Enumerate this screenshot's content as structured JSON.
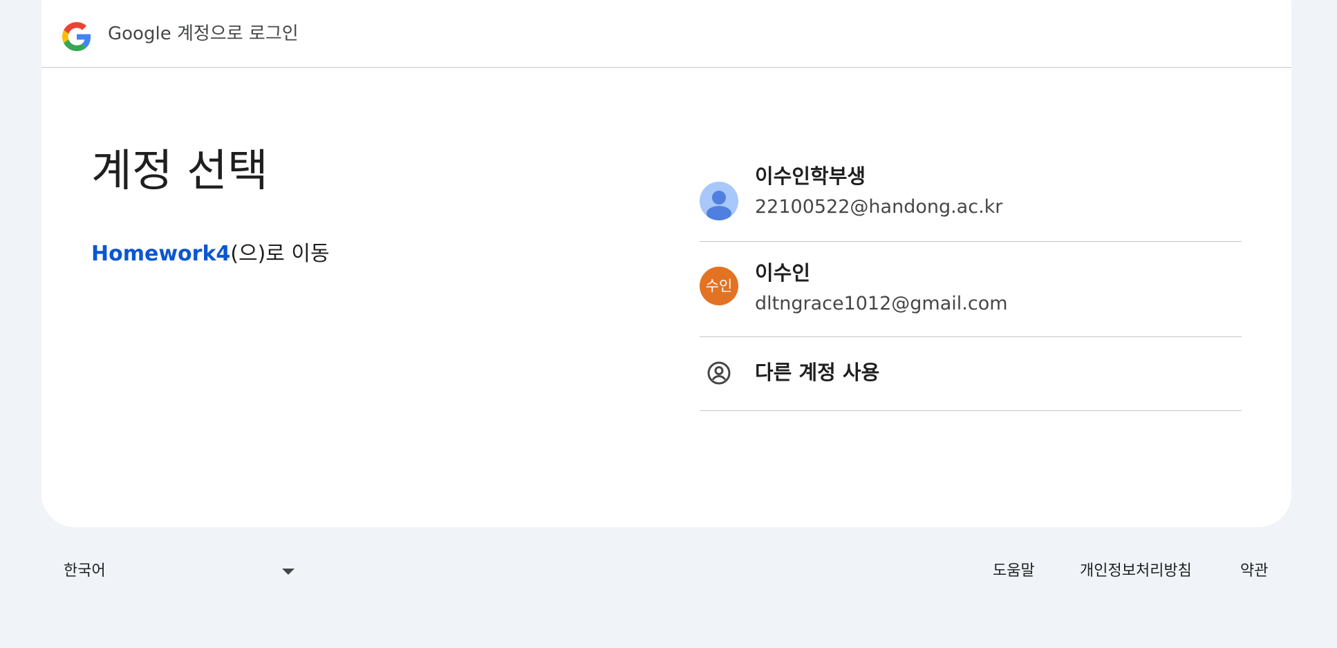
{
  "header": {
    "logo_icon": "google-g-logo",
    "title": "Google 계정으로 로그인"
  },
  "main": {
    "heading": "계정 선택",
    "continue_app_name": "Homework4",
    "continue_suffix": "(으)로 이동"
  },
  "accounts": [
    {
      "name": "이수인학부생",
      "email": "22100522@handong.ac.kr",
      "avatar_icon": "person-icon",
      "avatar_color": "#a8c7fa"
    },
    {
      "name": "이수인",
      "email": "dltngrace1012@gmail.com",
      "avatar_text": "수인",
      "avatar_color": "#e37222"
    }
  ],
  "other_account": {
    "label": "다른 계정 사용",
    "icon": "account-circle-icon"
  },
  "footer": {
    "language": "한국어",
    "links": {
      "help": "도움말",
      "privacy": "개인정보처리방침",
      "terms": "약관"
    }
  },
  "colors": {
    "page_background": "#f0f4f9",
    "card_background": "#ffffff",
    "link_blue": "#0b57d0",
    "divider": "#c4c7c5"
  }
}
